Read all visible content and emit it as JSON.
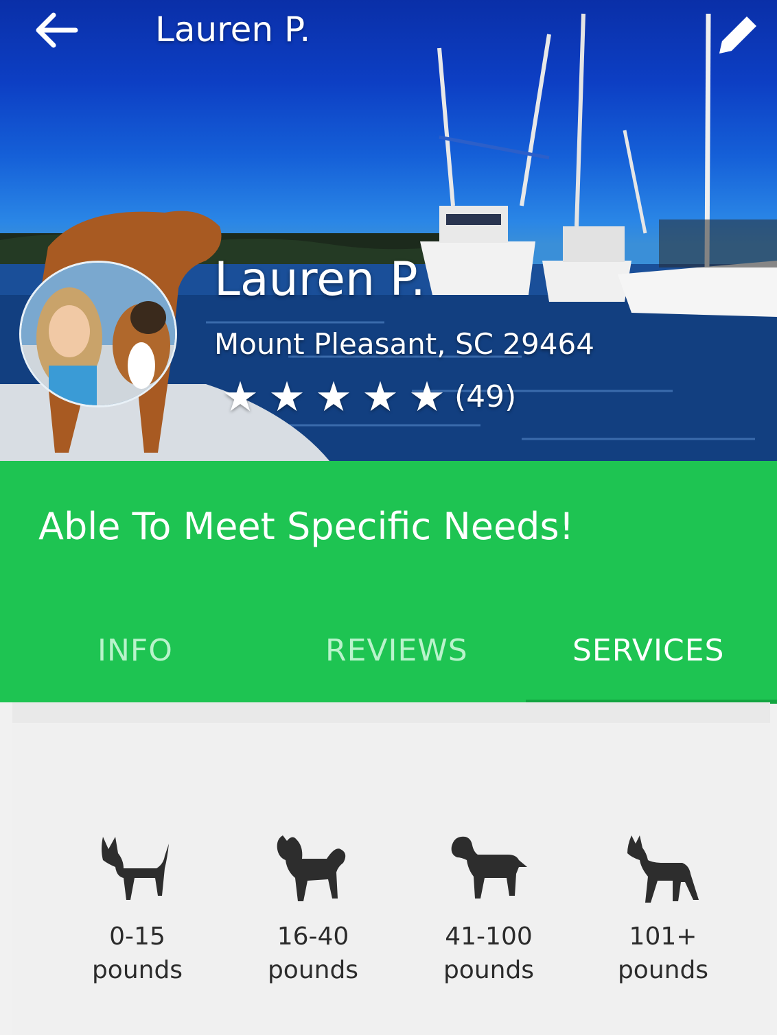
{
  "toolbar": {
    "title": "Lauren P.",
    "back_icon": "arrow-left-icon",
    "edit_icon": "pencil-icon"
  },
  "profile": {
    "name": "Lauren P.",
    "location": "Mount Pleasant, SC 29464",
    "rating_stars": 5,
    "star_glyph": "★",
    "review_count": "(49)"
  },
  "banner": {
    "tagline": "Able To Meet Specific Needs!",
    "color": "#1ec452"
  },
  "tabs": [
    {
      "label": "INFO",
      "selected": false
    },
    {
      "label": "REVIEWS",
      "selected": false
    },
    {
      "label": "SERVICES",
      "selected": true
    }
  ],
  "dog_sizes": [
    {
      "range": "0-15",
      "unit": "pounds",
      "icon": "small-dog-icon"
    },
    {
      "range": "16-40",
      "unit": "pounds",
      "icon": "medium-dog-icon"
    },
    {
      "range": "41-100",
      "unit": "pounds",
      "icon": "large-dog-icon"
    },
    {
      "range": "101+",
      "unit": "pounds",
      "icon": "giant-dog-icon"
    }
  ]
}
